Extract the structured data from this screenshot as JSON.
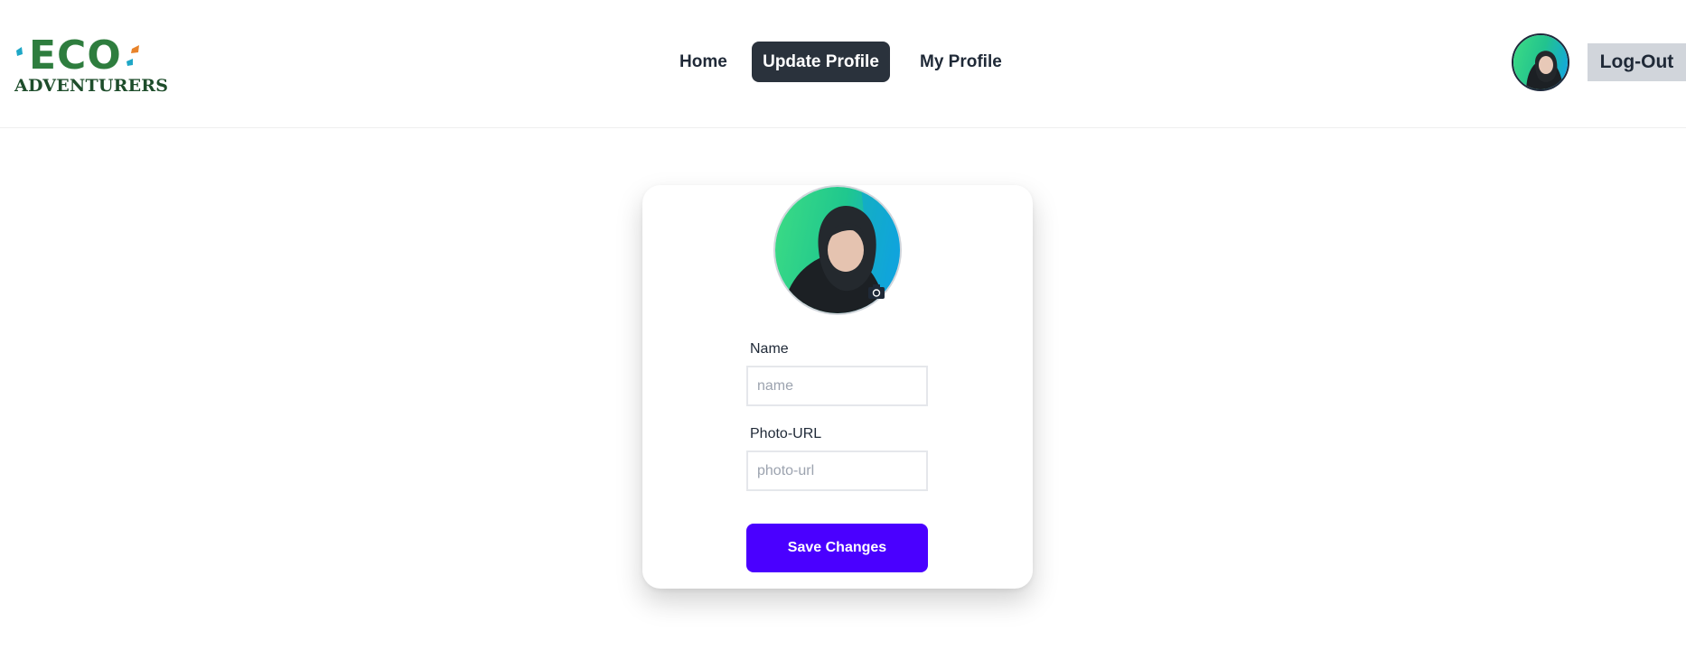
{
  "brand": {
    "logo_top": "ECO",
    "logo_bottom": "ADVENTURERS",
    "colors": {
      "green": "#2e7d3e",
      "dark_green": "#1e4d2b",
      "teal": "#1ea7c6",
      "orange": "#e8832a"
    }
  },
  "nav": {
    "items": [
      {
        "label": "Home"
      },
      {
        "label": "Update Profile",
        "active": true
      },
      {
        "label": "My Profile"
      }
    ],
    "logout_label": "Log-Out",
    "avatar_icon": "user-avatar"
  },
  "form": {
    "name_label": "Name",
    "name_placeholder": "name",
    "name_value": "",
    "photo_label": "Photo-URL",
    "photo_placeholder": "photo-url",
    "photo_value": "",
    "save_label": "Save Changes",
    "camera_icon": "camera-icon"
  },
  "colors": {
    "active_nav_bg": "#2a323c",
    "save_button_bg": "#4a00ff",
    "logout_bg": "#d1d5db"
  }
}
